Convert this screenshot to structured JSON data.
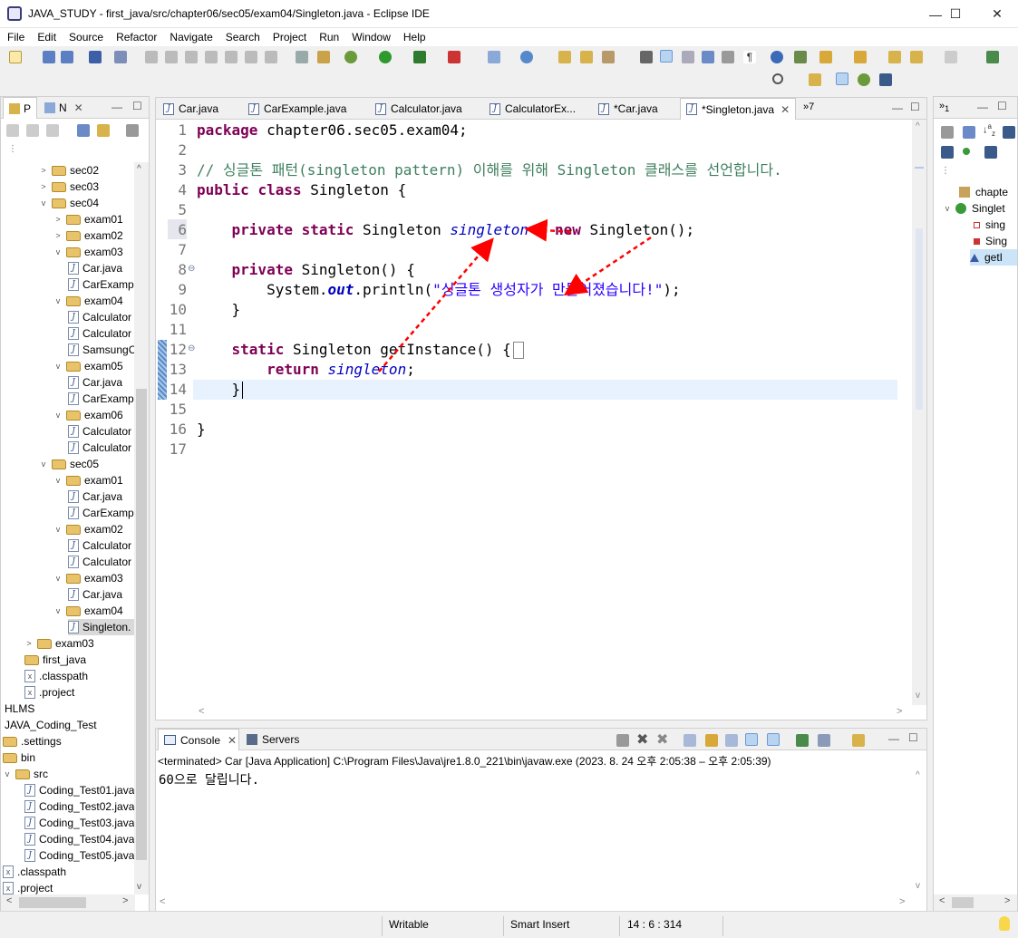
{
  "window": {
    "title": "JAVA_STUDY - first_java/src/chapter06/sec05/exam04/Singleton.java - Eclipse IDE",
    "minimize": "—",
    "maximize": "☐",
    "close": "✕"
  },
  "menu": [
    "File",
    "Edit",
    "Source",
    "Refactor",
    "Navigate",
    "Search",
    "Project",
    "Run",
    "Window",
    "Help"
  ],
  "left_panel": {
    "tabs": [
      "P",
      "N"
    ],
    "tree": [
      {
        "label": "sec02",
        "type": "folder",
        "indent": 1,
        "expanded": false
      },
      {
        "label": "sec03",
        "type": "folder",
        "indent": 1,
        "expanded": false
      },
      {
        "label": "sec04",
        "type": "folder",
        "indent": 1,
        "expanded": true
      },
      {
        "label": "exam01",
        "type": "folder",
        "indent": 2,
        "expanded": false
      },
      {
        "label": "exam02",
        "type": "folder",
        "indent": 2,
        "expanded": false
      },
      {
        "label": "exam03",
        "type": "folder",
        "indent": 2,
        "expanded": true
      },
      {
        "label": "Car.java",
        "type": "java",
        "indent": 3
      },
      {
        "label": "CarExamp",
        "type": "java",
        "indent": 3
      },
      {
        "label": "exam04",
        "type": "folder",
        "indent": 2,
        "expanded": true
      },
      {
        "label": "Calculator",
        "type": "java",
        "indent": 3
      },
      {
        "label": "Calculator",
        "type": "java",
        "indent": 3
      },
      {
        "label": "SamsungC",
        "type": "java",
        "indent": 3
      },
      {
        "label": "exam05",
        "type": "folder",
        "indent": 2,
        "expanded": true
      },
      {
        "label": "Car.java",
        "type": "java",
        "indent": 3
      },
      {
        "label": "CarExamp",
        "type": "java",
        "indent": 3
      },
      {
        "label": "exam06",
        "type": "folder",
        "indent": 2,
        "expanded": true
      },
      {
        "label": "Calculator",
        "type": "java",
        "indent": 3
      },
      {
        "label": "Calculator",
        "type": "java",
        "indent": 3
      },
      {
        "label": "sec05",
        "type": "folder",
        "indent": 1,
        "expanded": true
      },
      {
        "label": "exam01",
        "type": "folder",
        "indent": 2,
        "expanded": true
      },
      {
        "label": "Car.java",
        "type": "java",
        "indent": 3
      },
      {
        "label": "CarExamp",
        "type": "java",
        "indent": 3
      },
      {
        "label": "exam02",
        "type": "folder",
        "indent": 2,
        "expanded": true
      },
      {
        "label": "Calculator",
        "type": "java",
        "indent": 3
      },
      {
        "label": "Calculator",
        "type": "java",
        "indent": 3
      },
      {
        "label": "exam03",
        "type": "folder",
        "indent": 2,
        "expanded": true
      },
      {
        "label": "Car.java",
        "type": "java",
        "indent": 3
      },
      {
        "label": "exam04",
        "type": "folder",
        "indent": 2,
        "expanded": true
      },
      {
        "label": "Singleton.",
        "type": "java",
        "indent": 3,
        "selected": true
      },
      {
        "label": "exam03",
        "type": "folder",
        "indent": 0,
        "expanded": false
      },
      {
        "label": "first_java",
        "type": "folder",
        "indent": 0,
        "expanded": null
      },
      {
        "label": ".classpath",
        "type": "xml",
        "indent": 0
      },
      {
        "label": ".project",
        "type": "xml",
        "indent": 0
      },
      {
        "label": "HLMS",
        "type": "project",
        "indent": -1
      },
      {
        "label": "JAVA_Coding_Test",
        "type": "project",
        "indent": -1
      },
      {
        "label": ".settings",
        "type": "folder",
        "indent": -1,
        "expanded": null
      },
      {
        "label": "bin",
        "type": "folder",
        "indent": -1,
        "expanded": null
      },
      {
        "label": "src",
        "type": "folder",
        "indent": -1,
        "expanded": true
      },
      {
        "label": "Coding_Test01.java",
        "type": "java",
        "indent": 0
      },
      {
        "label": "Coding_Test02.java",
        "type": "java",
        "indent": 0
      },
      {
        "label": "Coding_Test03.java",
        "type": "java",
        "indent": 0
      },
      {
        "label": "Coding_Test04.java",
        "type": "java",
        "indent": 0
      },
      {
        "label": "Coding_Test05.java",
        "type": "java",
        "indent": 0
      },
      {
        "label": ".classpath",
        "type": "xml",
        "indent": -1
      },
      {
        "label": ".project",
        "type": "xml",
        "indent": -1
      }
    ]
  },
  "editor": {
    "tabs": [
      {
        "label": "Car.java",
        "active": false
      },
      {
        "label": "CarExample.java",
        "active": false
      },
      {
        "label": "Calculator.java",
        "active": false
      },
      {
        "label": "CalculatorEx...",
        "active": false
      },
      {
        "label": "*Car.java",
        "active": false
      },
      {
        "label": "*Singleton.java",
        "active": true
      }
    ],
    "overflow": "»7",
    "line_numbers": [
      "1",
      "2",
      "3",
      "4",
      "5",
      "6",
      "7",
      "8",
      "9",
      "10",
      "11",
      "12",
      "13",
      "14",
      "15",
      "16",
      "17"
    ],
    "code": {
      "l1_kw": "package",
      "l1_rest": " chapter06.sec05.exam04;",
      "l3_comment": "// 싱글톤 패턴(singleton pattern) 이해를 위해 Singleton 클래스를 선언합니다.",
      "l4_kw1": "public",
      "l4_kw2": "class",
      "l4_rest": " Singleton {",
      "l6_kw1": "private",
      "l6_kw2": "static",
      "l6_type": " Singleton ",
      "l6_field": "singleton",
      "l6_eq": " = ",
      "l6_new": "new",
      "l6_rest": " Singleton();",
      "l8_kw": "private",
      "l8_rest": " Singleton() {",
      "l9_pre": "System.",
      "l9_out": "out",
      "l9_mid": ".println(",
      "l9_str": "\"싱글톤 생성자가 만들어졌습니다!\"",
      "l9_end": ");",
      "l10": "}",
      "l12_kw": "static",
      "l12_rest": " Singleton getInstance() {",
      "l13_kw": "return",
      "l13_field": "singleton",
      "l13_end": ";",
      "l14": "}",
      "l16": "}"
    }
  },
  "outline": {
    "items": [
      "chapte",
      "Singlet",
      "sing",
      "Sing",
      "getI"
    ]
  },
  "console": {
    "tabs": [
      "Console",
      "Servers"
    ],
    "status": "<terminated> Car [Java Application] C:\\Program Files\\Java\\jre1.8.0_221\\bin\\javaw.exe  (2023. 8. 24 오후 2:05:38 – 오후 2:05:39)",
    "output": "60으로 달립니다."
  },
  "statusbar": {
    "mode": "Writable",
    "insert": "Smart Insert",
    "position": "14 : 6 : 314"
  },
  "colors": {
    "keyword": "#7f0055",
    "comment": "#3f7f5f",
    "field": "#0000c0",
    "string": "#2a00ff",
    "arrow": "#ff0000",
    "current_line": "#e8f2fe"
  }
}
